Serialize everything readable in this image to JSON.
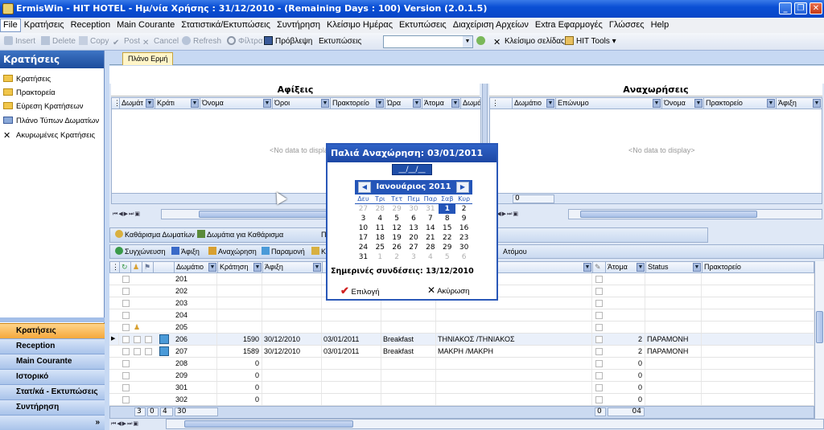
{
  "window": {
    "title": "ErmisWin - HIT HOTEL  - Ημ/νία Χρήσης : 31/12/2010 - (Remaining Days : 100) Version (2.0.1.5)",
    "min": "_",
    "max": "❐",
    "close": "✕"
  },
  "menu": [
    "File",
    "Κρατήσεις",
    "Reception",
    "Main Courante",
    "Στατιστικά/Εκτυπώσεις",
    "Συντήρηση",
    "Κλείσιμο Ημέρας",
    "Εκτυπώσεις",
    "Διαχείριση Αρχείων",
    "Extra Εφαρμογές",
    "Γλώσσες",
    "Help"
  ],
  "toolbar": {
    "insert": "Insert",
    "delete": "Delete",
    "copy": "Copy",
    "post": "Post",
    "cancel": "Cancel",
    "refresh": "Refresh",
    "filter": "Φίλτρα",
    "forecast": "Πρόβλεψη",
    "prints_label": "Εκτυπώσεις",
    "close_page": "Κλείσιμο σελίδας",
    "hit_tools": "HIT Tools ▾"
  },
  "sidebar": {
    "title": "Κρατήσεις",
    "items": [
      "Κρατήσεις",
      "Πρακτορεία",
      "Εύρεση Κρατήσεων",
      "Πλάνο Τύπων Δωματίων",
      "Ακυρωμένες Κρατήσεις"
    ],
    "nav": [
      "Κρατήσεις",
      "Reception",
      "Main Courante",
      "Ιστορικό",
      "Στατ/κά - Εκτυπώσεις",
      "Συντήρηση"
    ],
    "more": "»"
  },
  "tab": "Πλάνο Ερμή",
  "arrivals": {
    "title": "Αφίξεις",
    "columns": [
      "Δωμάτ",
      "Κράτι",
      "Όνομα",
      "Όροι",
      "Πρακτορείο",
      "Ώρα",
      "Άτομα",
      "Δωμά"
    ],
    "empty": "<No data to display>",
    "footer_value": ""
  },
  "departures": {
    "title": "Αναχωρήσεις",
    "columns": [
      "Δωμάτιο",
      "Επώνυμο",
      "Όνομα",
      "Πρακτορείο",
      "Άφιξη"
    ],
    "empty": "<No data to display>",
    "footer_value": "0"
  },
  "buttons1": {
    "cleaning": "Καθάρισμα Δωματίων",
    "rooms_to_clean": "Δωμάτια για Καθάρισμα",
    "trunc": "Π"
  },
  "buttons2": {
    "sync": "Συγχώνευση",
    "arrival": "Άφιξη",
    "departure": "Αναχώρηση",
    "stay": "Παραμονή",
    "trunc": "Κ",
    "persons": "Ατόμου"
  },
  "rooms": {
    "columns": {
      "room": "Δωμάτιο",
      "booking": "Κράτηση",
      "arrival": "Άφιξη",
      "persons": "Άτομα",
      "status": "Status",
      "agency": "Πρακτορείο"
    },
    "rows": [
      {
        "room": "201",
        "booking": "",
        "arrival": "",
        "departure": "",
        "terms": "",
        "name": "",
        "persons": "",
        "status": ""
      },
      {
        "room": "202",
        "booking": "",
        "arrival": "",
        "departure": "",
        "terms": "",
        "name": "",
        "persons": "",
        "status": ""
      },
      {
        "room": "203",
        "booking": "",
        "arrival": "",
        "departure": "",
        "terms": "",
        "name": "",
        "persons": "",
        "status": ""
      },
      {
        "room": "204",
        "booking": "",
        "arrival": "",
        "departure": "",
        "terms": "",
        "name": "",
        "persons": "",
        "status": ""
      },
      {
        "room": "205",
        "booking": "",
        "arrival": "",
        "departure": "",
        "terms": "",
        "name": "",
        "persons": "",
        "status": ""
      },
      {
        "room": "206",
        "booking": "1590",
        "arrival": "30/12/2010",
        "departure": "03/01/2011",
        "terms": "Breakfast",
        "name": "ΤΗΝΙΑΚΟΣ /ΤΗΝΙΑΚΟΣ",
        "persons": "2",
        "status": "ΠΑΡΑΜΟΝΗ"
      },
      {
        "room": "207",
        "booking": "1589",
        "arrival": "30/12/2010",
        "departure": "03/01/2011",
        "terms": "Breakfast",
        "name": "ΜΑΚΡΗ /ΜΑΚΡΗ",
        "persons": "2",
        "status": "ΠΑΡΑΜΟΝΗ"
      },
      {
        "room": "208",
        "booking": "0",
        "arrival": "",
        "departure": "",
        "terms": "",
        "name": "",
        "persons": "0",
        "status": ""
      },
      {
        "room": "209",
        "booking": "0",
        "arrival": "",
        "departure": "",
        "terms": "",
        "name": "",
        "persons": "0",
        "status": ""
      },
      {
        "room": "301",
        "booking": "0",
        "arrival": "",
        "departure": "",
        "terms": "",
        "name": "",
        "persons": "0",
        "status": ""
      },
      {
        "room": "302",
        "booking": "0",
        "arrival": "",
        "departure": "",
        "terms": "",
        "name": "",
        "persons": "0",
        "status": ""
      }
    ],
    "footer": {
      "c1": "3",
      "c2": "0",
      "c3": "4",
      "rooms": "30",
      "f1": "0",
      "persons": "04"
    }
  },
  "popup": {
    "title": "Παλιά Αναχώρηση:  03/01/2011",
    "input": "__/__/__",
    "month": "Ιανουάριος 2011",
    "prev": "◀",
    "next": "▶",
    "dows": [
      "Δευ",
      "Τρι",
      "Τετ",
      "Πεμ",
      "Παρ",
      "Σαβ",
      "Κυρ"
    ],
    "weeks": [
      [
        "27",
        "28",
        "29",
        "30",
        "31",
        "1",
        "2"
      ],
      [
        "3",
        "4",
        "5",
        "6",
        "7",
        "8",
        "9"
      ],
      [
        "10",
        "11",
        "12",
        "13",
        "14",
        "15",
        "16"
      ],
      [
        "17",
        "18",
        "19",
        "20",
        "21",
        "22",
        "23"
      ],
      [
        "24",
        "25",
        "26",
        "27",
        "28",
        "29",
        "30"
      ],
      [
        "31",
        "1",
        "2",
        "3",
        "4",
        "5",
        "6"
      ]
    ],
    "selected_day": "1",
    "today_label": "Σημερινές συνδέσεις: 13/12/2010",
    "ok": "Επιλογή",
    "cancel": "Ακύρωση"
  },
  "colors": {
    "accent": "#2455b8",
    "titlebar": "#0a4fd4",
    "active_nav": "#f5a83c"
  }
}
